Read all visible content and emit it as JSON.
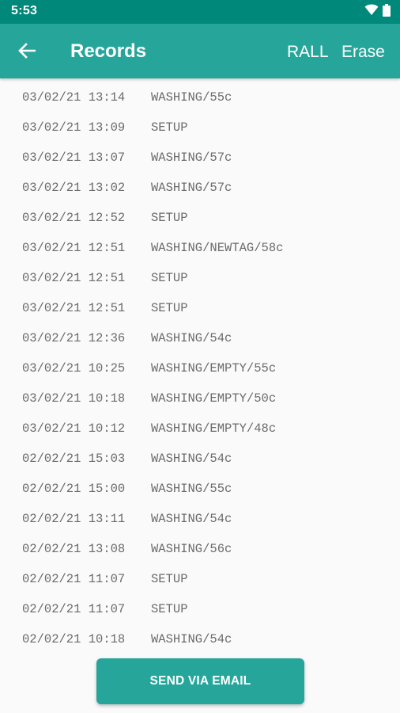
{
  "status_bar": {
    "time": "5:53",
    "icons": [
      "wifi-icon",
      "battery-icon"
    ]
  },
  "app_bar": {
    "title": "Records",
    "actions": {
      "rall": "RALL",
      "erase": "Erase"
    },
    "back_icon": "arrow-left-icon",
    "color": "#26a69a"
  },
  "records": [
    {
      "datetime": "03/02/21 13:14",
      "event": "WASHING/55c"
    },
    {
      "datetime": "03/02/21 13:09",
      "event": "SETUP"
    },
    {
      "datetime": "03/02/21 13:07",
      "event": "WASHING/57c"
    },
    {
      "datetime": "03/02/21 13:02",
      "event": "WASHING/57c"
    },
    {
      "datetime": "03/02/21 12:52",
      "event": "SETUP"
    },
    {
      "datetime": "03/02/21 12:51",
      "event": "WASHING/NEWTAG/58c"
    },
    {
      "datetime": "03/02/21 12:51",
      "event": "SETUP"
    },
    {
      "datetime": "03/02/21 12:51",
      "event": "SETUP"
    },
    {
      "datetime": "03/02/21 12:36",
      "event": "WASHING/54c"
    },
    {
      "datetime": "03/02/21 10:25",
      "event": "WASHING/EMPTY/55c"
    },
    {
      "datetime": "03/02/21 10:18",
      "event": "WASHING/EMPTY/50c"
    },
    {
      "datetime": "03/02/21 10:12",
      "event": "WASHING/EMPTY/48c"
    },
    {
      "datetime": "02/02/21 15:03",
      "event": "WASHING/54c"
    },
    {
      "datetime": "02/02/21 15:00",
      "event": "WASHING/55c"
    },
    {
      "datetime": "02/02/21 13:11",
      "event": "WASHING/54c"
    },
    {
      "datetime": "02/02/21 13:08",
      "event": "WASHING/56c"
    },
    {
      "datetime": "02/02/21 11:07",
      "event": "SETUP"
    },
    {
      "datetime": "02/02/21 11:07",
      "event": "SETUP"
    },
    {
      "datetime": "02/02/21 10:18",
      "event": "WASHING/54c"
    }
  ],
  "send_button": {
    "label": "SEND VIA EMAIL"
  }
}
